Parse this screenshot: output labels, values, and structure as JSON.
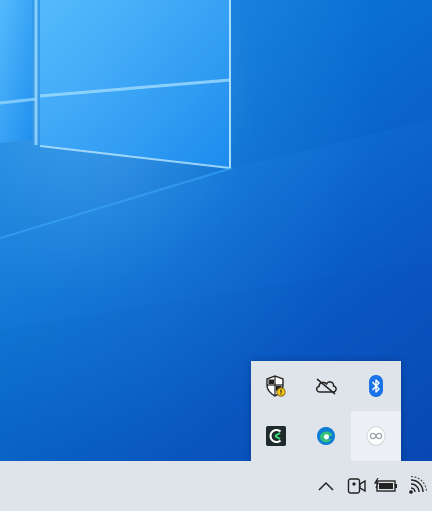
{
  "desktop": {
    "wallpaper": "windows-10-hero-light-blue",
    "colors": {
      "accent": "#0a74d8",
      "taskbar": "#dfe4ea",
      "popup": "#dfe4ea"
    }
  },
  "tray_overflow": {
    "icons": [
      {
        "name": "windows-security-warning-icon"
      },
      {
        "name": "onedrive-offline-icon"
      },
      {
        "name": "bluetooth-icon"
      },
      {
        "name": "app-c-icon"
      },
      {
        "name": "edge-icon"
      },
      {
        "name": "game-controller-icon"
      }
    ]
  },
  "taskbar": {
    "icons": [
      {
        "name": "show-hidden-icons-chevron-icon"
      },
      {
        "name": "meet-now-camera-icon"
      },
      {
        "name": "battery-charging-icon"
      },
      {
        "name": "wifi-icon"
      }
    ]
  }
}
